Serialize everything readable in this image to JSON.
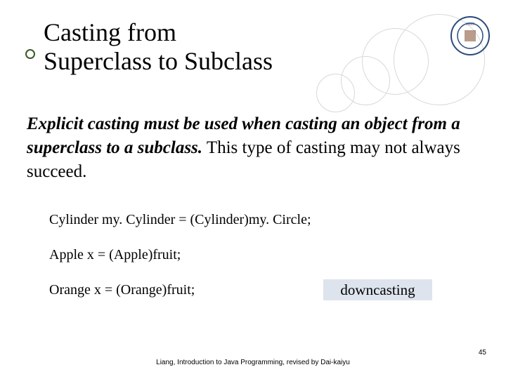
{
  "title_line1": "Casting from",
  "title_line2": "Superclass to Subclass",
  "body": {
    "bold_part": "Explicit casting must be used when casting an object from a superclass to a subclass.",
    "rest_part": "  This type of casting may not always succeed."
  },
  "code": {
    "line1": "Cylinder my. Cylinder = (Cylinder)my. Circle;",
    "line2": "Apple x = (Apple)fruit;",
    "line3": "Orange x = (Orange)fruit;"
  },
  "label": "downcasting",
  "footer": "Liang, Introduction to Java Programming, revised by Dai-kaiyu",
  "page": "45"
}
